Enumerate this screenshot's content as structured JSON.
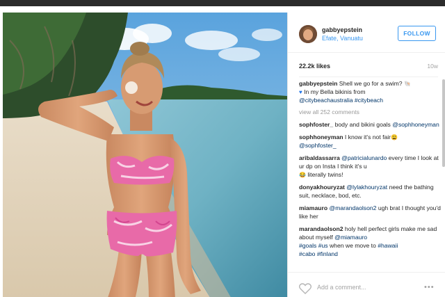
{
  "post": {
    "username": "gabbyepstein",
    "location": "Efate, Vanuatu",
    "follow_label": "FOLLOW",
    "likes": "22.2k likes",
    "time": "10w"
  },
  "caption": {
    "username": "gabbyepstein",
    "text1": " Shell we go for a swim?",
    "text2": " In my Bella bikinis from",
    "tag1": "@citybeachaustralia",
    "tag2": "#citybeach"
  },
  "view_all": "view all 252 comments",
  "comments": [
    {
      "user": "sophfoster_",
      "text": " body and bikini goals ",
      "mention": "@sophhoneyman"
    },
    {
      "user": "sophhoneyman",
      "text": " I know it's not fair",
      "mention": "@sophfoster_"
    },
    {
      "user": "aribaldassarra",
      "mention1": "@patricialunardo",
      "text": " every time I look at ur dp on Insta I think it's u",
      "text2": " literally twins!"
    },
    {
      "user": "donyakhouryzat",
      "mention1": "@lylakhouryzat",
      "text": " need the bathing suit, necklace, bod, etc."
    },
    {
      "user": "miamauro",
      "mention1": "@marandaolson2",
      "text": " ugh brat I thought you'd like her"
    },
    {
      "user": "marandaolson2",
      "text": " holy hell perfect girls make me sad about myself ",
      "mention1": "@miamauro",
      "tag1": "#goals",
      "tag2": "#us",
      "text2": " when we move to ",
      "tag3": "#hawaii",
      "tag4": "#cabo",
      "tag5": "#finland"
    }
  ],
  "footer": {
    "add_comment_placeholder": "Add a comment...",
    "more_label": "•••",
    "like_icon": "heart-outline-icon",
    "more_icon": "ellipsis-icon"
  },
  "colors": {
    "link_blue": "#3897f0",
    "hashtag": "#003569"
  }
}
